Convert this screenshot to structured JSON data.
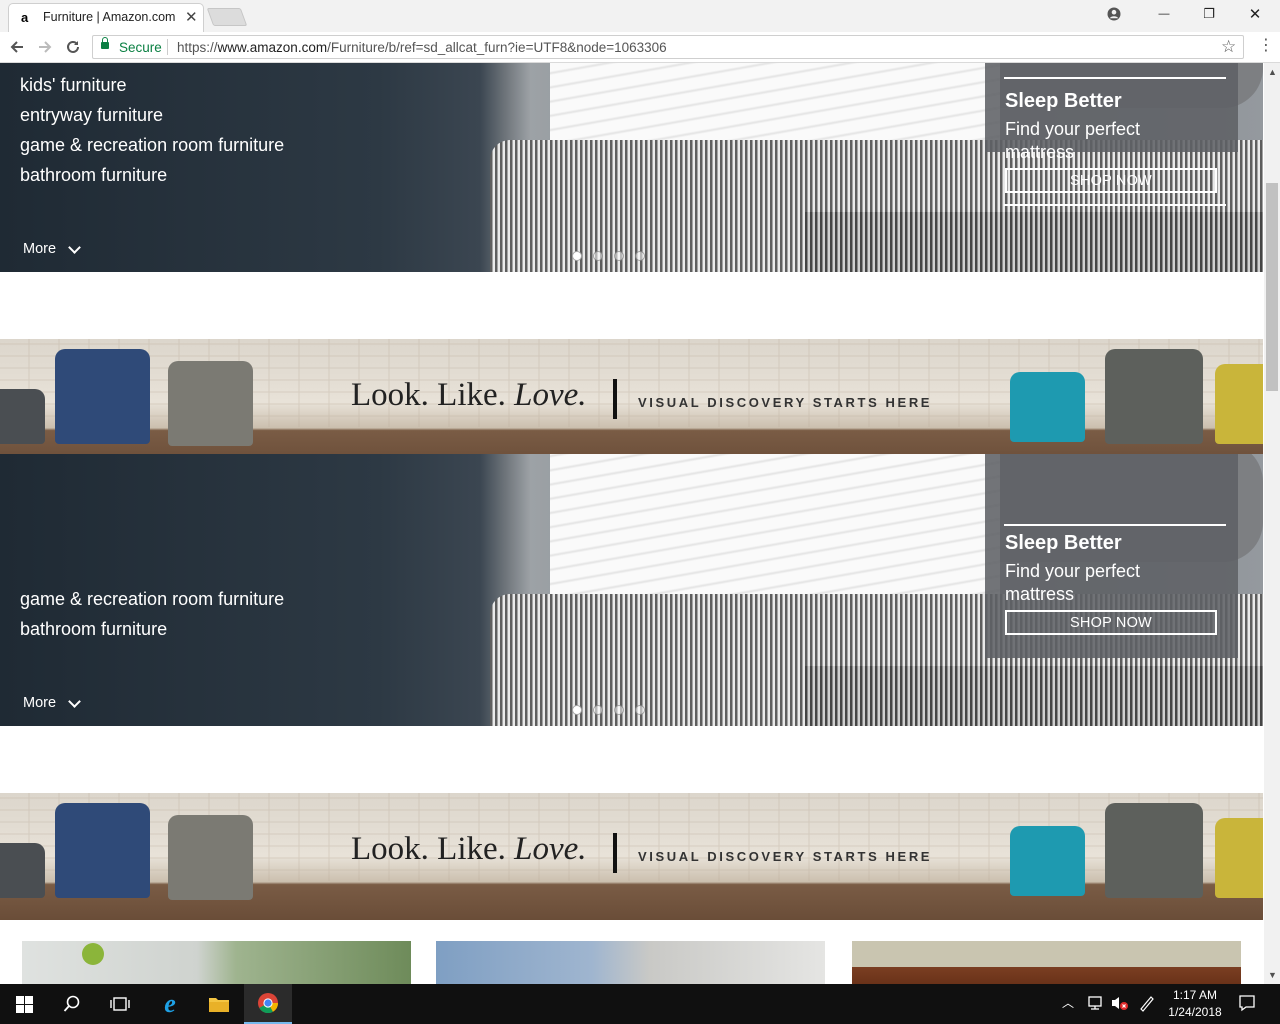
{
  "browser": {
    "tab_favicon": "a",
    "tab_title": "Furniture | Amazon.com",
    "tab_close": "✕",
    "back_icon": "arrow-left-icon",
    "forward_icon": "arrow-right-icon",
    "reload_icon": "reload-icon",
    "secure_label": "Secure",
    "url_scheme": "https://",
    "url_host": "www.amazon.com",
    "url_path": "/Furniture/b/ref=sd_allcat_furn?ie=UTF8&node=1063306",
    "star": "☆",
    "minimize": "—",
    "restore": "❐",
    "close": "✕"
  },
  "hero_top": {
    "categories": [
      "kids' furniture",
      "entryway furniture",
      "game & recreation room furniture",
      "bathroom furniture"
    ],
    "more_label": "More",
    "promo": {
      "title": "Sleep Better",
      "subtitle": "Find your perfect mattress",
      "button": "SHOP NOW"
    },
    "slide_count": 4,
    "active_slide": 1
  },
  "hero_bottom": {
    "categories": [
      "game & recreation room furniture",
      "bathroom furniture"
    ],
    "more_label": "More",
    "promo": {
      "title": "Sleep Better",
      "subtitle": "Find your perfect mattress",
      "button": "SHOP NOW"
    },
    "slide_count": 4,
    "active_slide": 1
  },
  "banner": {
    "slogan_a": "Look. Like. ",
    "slogan_b": "Love.",
    "tagline": "VISUAL DISCOVERY STARTS HERE"
  },
  "taskbar": {
    "time": "1:17 AM",
    "date": "1/24/2018"
  },
  "colors": {
    "secure_green": "#0b8043",
    "promo_overlay": "#5f6165",
    "taskbar": "#101010"
  }
}
